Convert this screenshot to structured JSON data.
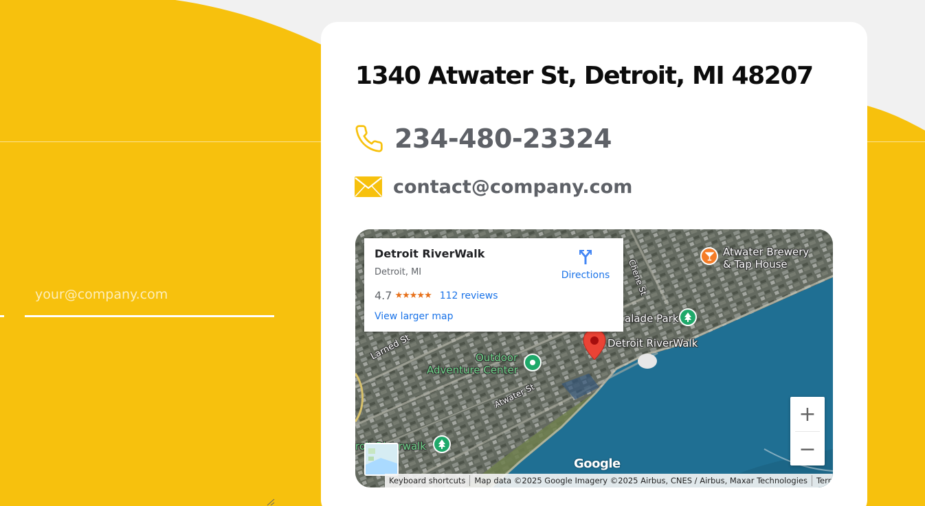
{
  "colors": {
    "accent_yellow": "#f7c10d",
    "card_bg": "#ffffff",
    "heading": "#0c0c0c",
    "muted_text": "#5e6167",
    "link_blue": "#1a73e8",
    "water": "#1f6f93"
  },
  "form": {
    "email_placeholder": "your@company.com"
  },
  "contact": {
    "address": "1340 Atwater St, Detroit, MI 48207",
    "phone": "234-480-23324",
    "email": "contact@company.com",
    "phone_icon": "phone-icon",
    "email_icon": "envelope-icon"
  },
  "map": {
    "info": {
      "title": "Detroit RiverWalk",
      "subtitle": "Detroit, MI",
      "rating": "4.7",
      "stars": "★★★★★",
      "reviews": "112 reviews",
      "larger_map": "View larger map",
      "directions": "Directions"
    },
    "labels": {
      "brewery_1": "Atwater Brewery",
      "brewery_2": "& Tap House",
      "park": "alade Park",
      "pin": "Detroit RiverWalk",
      "outdoor_1": "Outdoor",
      "outdoor_2": "Adventure Center",
      "larned": "Larned St",
      "atwater": "Atwater St",
      "chene": "Chene St",
      "riverwalk_cut": "roit Riverwalk"
    },
    "zoom_in": "+",
    "zoom_out": "−",
    "logo": "Google",
    "attribution": {
      "shortcuts": "Keyboard shortcuts",
      "data": "Map data ©2025 Google Imagery ©2025 Airbus, CNES / Airbus, Maxar Technologies",
      "terms": "Terms"
    }
  }
}
